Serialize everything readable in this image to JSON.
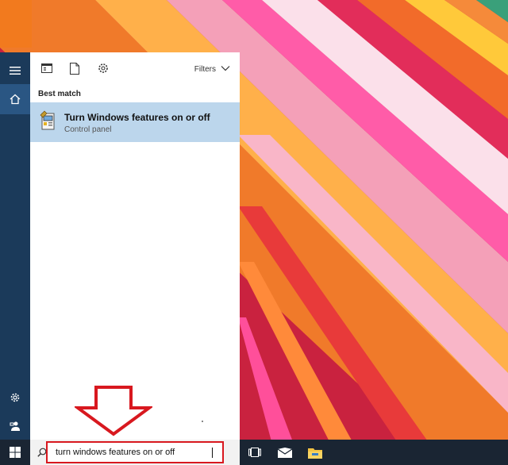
{
  "panel": {
    "filters_label": "Filters",
    "section_label": "Best match",
    "result": {
      "title": "Turn Windows features on or off",
      "subtitle": "Control panel",
      "icon": "control-panel-icon"
    }
  },
  "rail": {
    "items": [
      {
        "icon": "hamburger-menu-icon"
      },
      {
        "icon": "home-icon"
      },
      {
        "icon": "settings-gear-icon"
      },
      {
        "icon": "feedback-icon"
      }
    ]
  },
  "toolbar_icons": [
    "apps-icon",
    "documents-icon",
    "web-settings-icon"
  ],
  "taskbar": {
    "search_value": "turn windows features on or off",
    "apps": [
      "task-view-icon",
      "mail-icon",
      "file-explorer-icon"
    ]
  },
  "colors": {
    "rail": "#1b3a5a",
    "rail_active": "#2a5683",
    "result_highlight": "#bcd6ec",
    "annotation_red": "#d8181f",
    "taskbar": "#1a2533"
  }
}
